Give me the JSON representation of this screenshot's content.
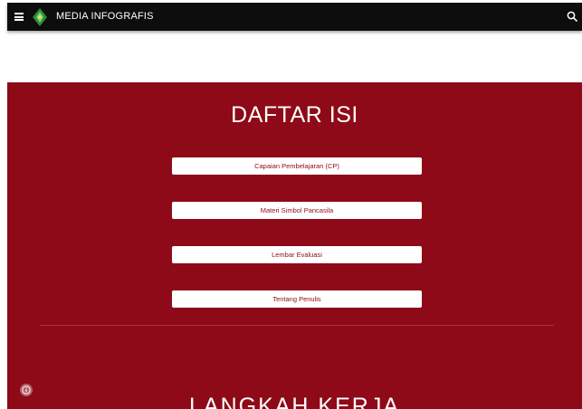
{
  "header": {
    "menu_icon": "hamburger-menu-icon",
    "logo_icon": "green-emblem-logo",
    "site_title": "MEDIA INFOGRAFIS",
    "search_icon": "search-icon",
    "background": "#0d0d0d"
  },
  "main": {
    "background": "#8e0a18",
    "title": "DAFTAR ISI",
    "buttons": [
      {
        "label": "Capaian Pembelajaran (CP)"
      },
      {
        "label": "Materi Simbol Pancasila"
      },
      {
        "label": "Lembar Evaluasi"
      },
      {
        "label": "Tentang Penulis"
      }
    ],
    "info_icon": "info-icon",
    "next_section_title": "LANGKAH KERJA"
  }
}
